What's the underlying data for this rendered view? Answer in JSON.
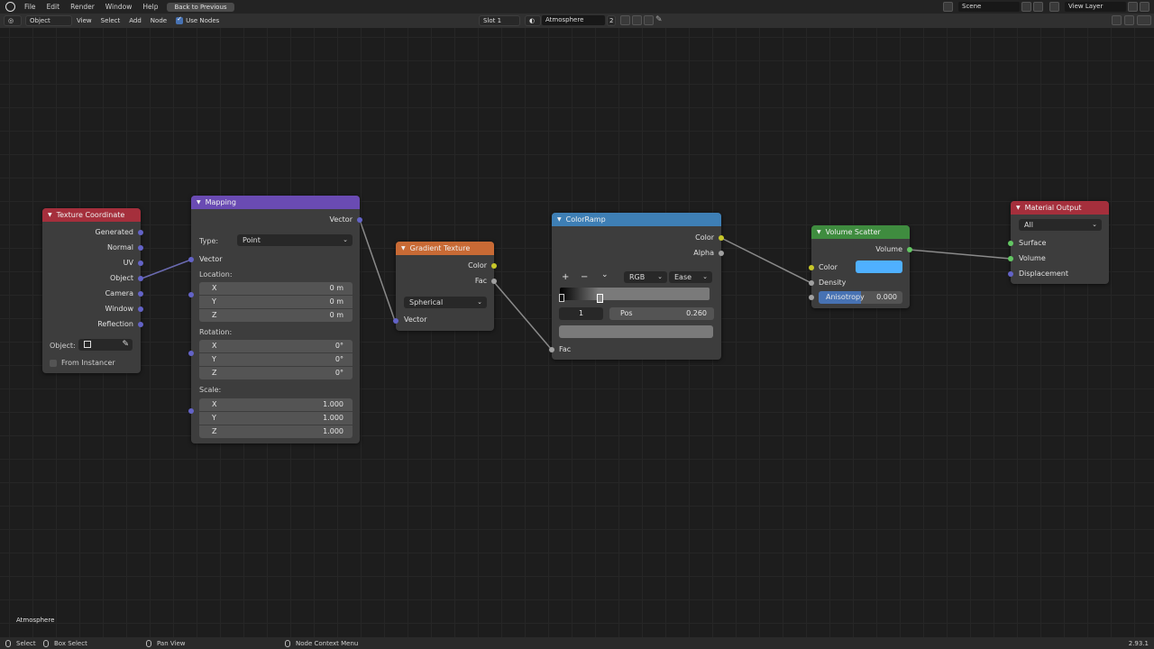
{
  "topbar": {
    "menu": [
      "File",
      "Edit",
      "Render",
      "Window",
      "Help"
    ],
    "back_label": "Back to Previous",
    "scene": "Scene",
    "view_layer": "View Layer"
  },
  "header": {
    "mode": "Object",
    "menus": [
      "View",
      "Select",
      "Add",
      "Node"
    ],
    "use_nodes_label": "Use Nodes",
    "slot": "Slot 1",
    "material_name": "Atmosphere",
    "user_count": "2"
  },
  "nodes": {
    "texcoord": {
      "title": "Texture Coordinate",
      "outputs": [
        "Generated",
        "Normal",
        "UV",
        "Object",
        "Camera",
        "Window",
        "Reflection"
      ],
      "object_label": "Object:",
      "from_instancer": "From Instancer"
    },
    "mapping": {
      "title": "Mapping",
      "output": "Vector",
      "type_label": "Type:",
      "type_value": "Point",
      "vector_input": "Vector",
      "location_label": "Location:",
      "location": [
        {
          "axis": "X",
          "value": "0 m"
        },
        {
          "axis": "Y",
          "value": "0 m"
        },
        {
          "axis": "Z",
          "value": "0 m"
        }
      ],
      "rotation_label": "Rotation:",
      "rotation": [
        {
          "axis": "X",
          "value": "0°"
        },
        {
          "axis": "Y",
          "value": "0°"
        },
        {
          "axis": "Z",
          "value": "0°"
        }
      ],
      "scale_label": "Scale:",
      "scale": [
        {
          "axis": "X",
          "value": "1.000"
        },
        {
          "axis": "Y",
          "value": "1.000"
        },
        {
          "axis": "Z",
          "value": "1.000"
        }
      ]
    },
    "gradient": {
      "title": "Gradient Texture",
      "out_color": "Color",
      "out_fac": "Fac",
      "type_value": "Spherical",
      "in_vector": "Vector"
    },
    "colorramp": {
      "title": "ColorRamp",
      "out_color": "Color",
      "out_alpha": "Alpha",
      "add": "+",
      "remove": "−",
      "menu": "⌄",
      "color_mode": "RGB",
      "interpolation": "Ease",
      "stop_index": "1",
      "pos_label": "Pos",
      "pos_value": "0.260",
      "in_fac": "Fac"
    },
    "volume": {
      "title": "Volume Scatter",
      "out_volume": "Volume",
      "in_color": "Color",
      "color_swatch": "#4fb0ff",
      "in_density": "Density",
      "anisotropy_label": "Anisotropy",
      "anisotropy_value": "0.000",
      "anisotropy_fraction": 0.5
    },
    "output": {
      "title": "Material Output",
      "target": "All",
      "inputs": [
        "Surface",
        "Volume",
        "Displacement"
      ]
    }
  },
  "colors": {
    "texcoord_head": "#a52f3c",
    "mapping_head": "#6a4bb3",
    "gradient_head": "#c86a35",
    "colorramp_head": "#3e7fb5",
    "volume_head": "#3f8c3f",
    "output_head": "#a52f3c"
  },
  "canvas_label": "Atmosphere",
  "statusbar": {
    "select": "Select",
    "box_select": "Box Select",
    "pan_view": "Pan View",
    "context_menu": "Node Context Menu",
    "version": "2.93.1"
  }
}
